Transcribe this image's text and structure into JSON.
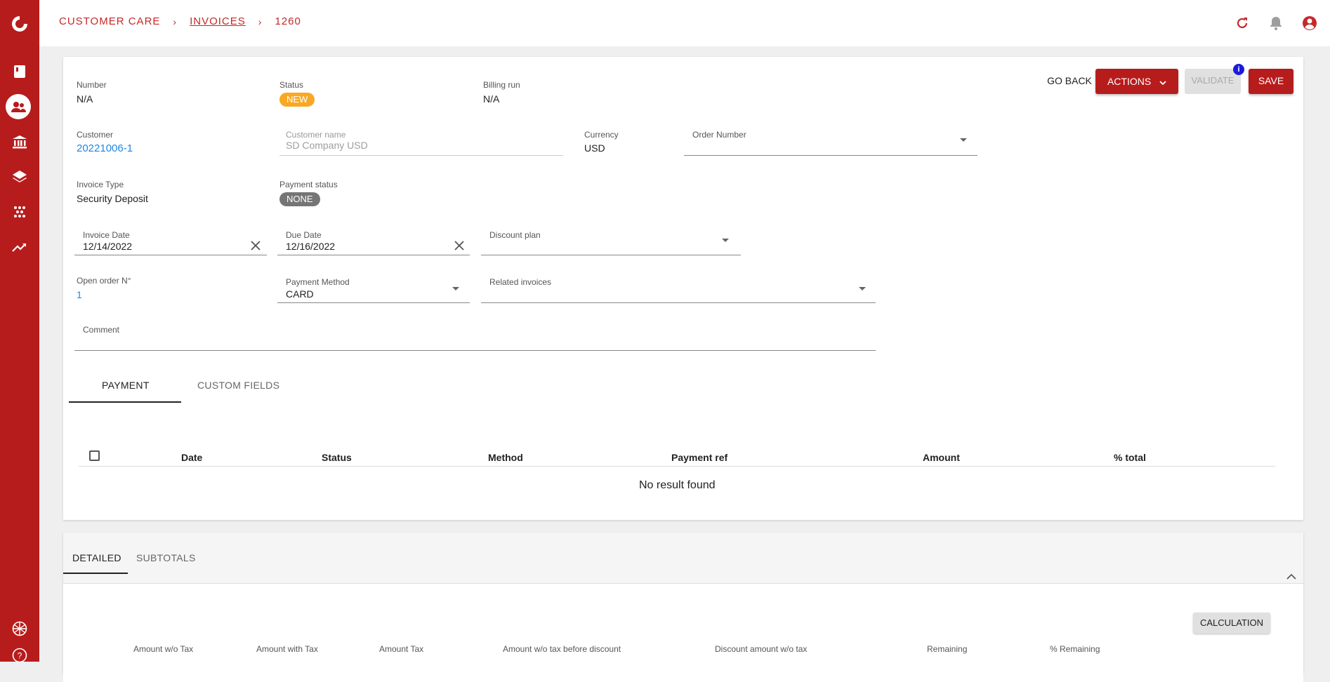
{
  "sidebar": {
    "icons": [
      "logo-icon",
      "book-icon",
      "customers-icon",
      "bank-icon",
      "layers-icon",
      "apps-icon",
      "trending-icon",
      "language-icon",
      "help-icon"
    ]
  },
  "breadcrumb": {
    "root": "CUSTOMER CARE",
    "section": "INVOICES",
    "current": "1260"
  },
  "colors": {
    "brand": "#b71c1c",
    "status_new": "#f9a825",
    "status_none": "#757575",
    "link": "#1e88e5"
  },
  "actions": {
    "go_back": "GO BACK",
    "actions": "ACTIONS",
    "validate": "VALIDATE",
    "validate_badge": "i",
    "save": "SAVE"
  },
  "invoice": {
    "number_label": "Number",
    "number": "N/A",
    "status_label": "Status",
    "status": "NEW",
    "billing_run_label": "Billing run",
    "billing_run": "N/A",
    "customer_label": "Customer",
    "customer": "20221006-1",
    "customer_name_label": "Customer name",
    "customer_name": "SD Company USD",
    "currency_label": "Currency",
    "currency": "USD",
    "order_number_label": "Order Number",
    "order_number": "",
    "invoice_type_label": "Invoice Type",
    "invoice_type": "Security Deposit",
    "payment_status_label": "Payment status",
    "payment_status": "NONE",
    "invoice_date_label": "Invoice Date",
    "invoice_date": "12/14/2022",
    "due_date_label": "Due Date",
    "due_date": "12/16/2022",
    "discount_plan_label": "Discount plan",
    "discount_plan": "",
    "open_order_label": "Open order N°",
    "open_order": "1",
    "payment_method_label": "Payment Method",
    "payment_method": "CARD",
    "related_invoices_label": "Related invoices",
    "related_invoices": "",
    "comment_label": "Comment",
    "comment": ""
  },
  "tabs": [
    "PAYMENT",
    "CUSTOM FIELDS"
  ],
  "payments_table": {
    "columns": [
      "Date",
      "Status",
      "Method",
      "Payment ref",
      "Amount",
      "% total"
    ],
    "empty_message": "No result found"
  },
  "bottom": {
    "tabs": [
      "DETAILED",
      "SUBTOTALS"
    ],
    "calculation": "CALCULATION",
    "columns": [
      "Amount w/o Tax",
      "Amount with Tax",
      "Amount Tax",
      "Amount w/o tax before discount",
      "Discount amount w/o tax",
      "Remaining",
      "% Remaining"
    ]
  }
}
